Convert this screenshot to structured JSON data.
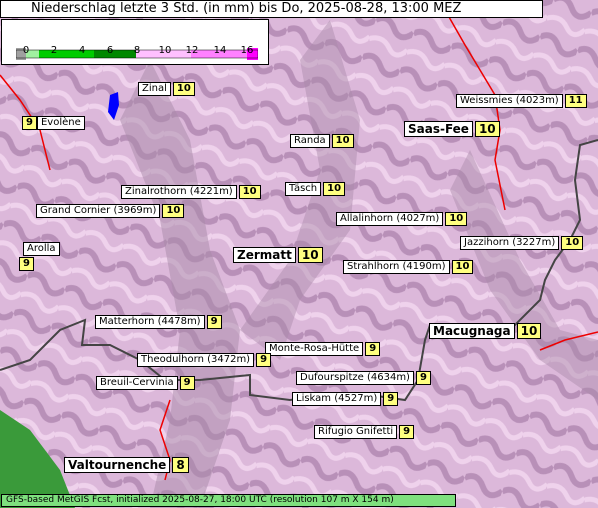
{
  "title": "Niederschlag letzte 3 Std. (in mm) bis Do, 2025-08-28, 13:00 MEZ",
  "legend": {
    "ticks": [
      "0",
      "2",
      "4",
      "6",
      "8",
      "10",
      "12",
      "14",
      "16"
    ],
    "colors": {
      "none": "#a0a0a0",
      "low": "#00cc00",
      "mid": "#008800",
      "pink_light": "#ffc0ff",
      "pink": "#ff80ff",
      "magenta": "#ff00ff"
    }
  },
  "places": [
    {
      "id": "zinal",
      "name": "Zinal",
      "value": "10"
    },
    {
      "id": "evolene",
      "name": "Evolène",
      "value": "9"
    },
    {
      "id": "weissmies",
      "name": "Weissmies (4023m)",
      "value": "11"
    },
    {
      "id": "saas-fee",
      "name": "Saas-Fee",
      "value": "10"
    },
    {
      "id": "randa",
      "name": "Randa",
      "value": "10"
    },
    {
      "id": "tasch",
      "name": "Täsch",
      "value": "10"
    },
    {
      "id": "zinalrothorn",
      "name": "Zinalrothorn (4221m)",
      "value": "10"
    },
    {
      "id": "grand-cornier",
      "name": "Grand Cornier (3969m)",
      "value": "10"
    },
    {
      "id": "allalinhorn",
      "name": "Allalinhorn (4027m)",
      "value": "10"
    },
    {
      "id": "jazzihorn",
      "name": "Jazzihorn (3227m)",
      "value": "10"
    },
    {
      "id": "arolla",
      "name": "Arolla",
      "value": "9"
    },
    {
      "id": "zermatt",
      "name": "Zermatt",
      "value": "10"
    },
    {
      "id": "strahlhorn",
      "name": "Strahlhorn (4190m)",
      "value": "10"
    },
    {
      "id": "matterhorn",
      "name": "Matterhorn (4478m)",
      "value": "9"
    },
    {
      "id": "macugnaga",
      "name": "Macugnaga",
      "value": "10"
    },
    {
      "id": "monte-rosa-hutte",
      "name": "Monte-Rosa-Hütte",
      "value": "9"
    },
    {
      "id": "theodulhorn",
      "name": "Theodulhorn (3472m)",
      "value": "9"
    },
    {
      "id": "dufourspitze",
      "name": "Dufourspitze (4634m)",
      "value": "9"
    },
    {
      "id": "breuil-cervinia",
      "name": "Breuil-Cervinia",
      "value": "9"
    },
    {
      "id": "liskam",
      "name": "Liskam (4527m)",
      "value": "9"
    },
    {
      "id": "rifugio-gnifetti",
      "name": "Rifugio Gnifetti",
      "value": "9"
    },
    {
      "id": "valtournenche",
      "name": "Valtournenche",
      "value": "8"
    }
  ],
  "footer": "GFS-based MetGIS Fcst, initialized 2025-08-27, 18:00 UTC  (resolution 107 m X 154 m)"
}
